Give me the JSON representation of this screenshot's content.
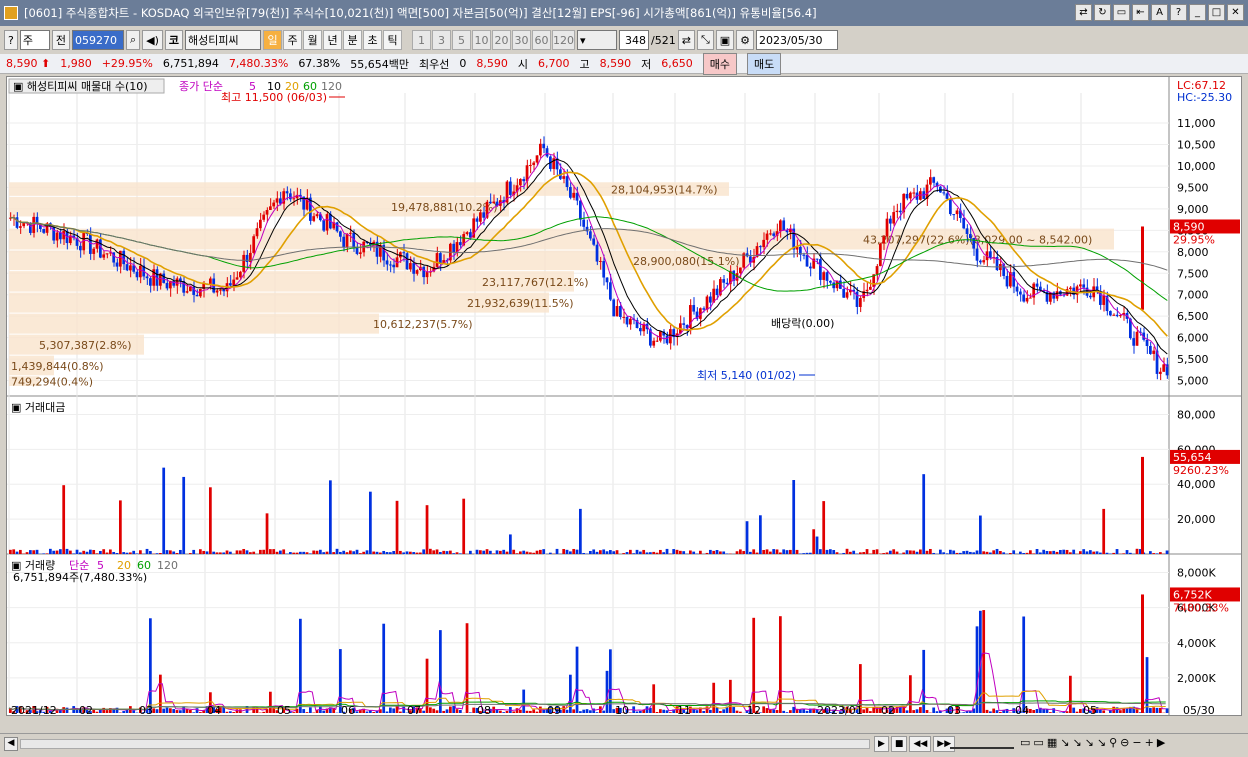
{
  "window": {
    "title": "[0601] 주식종합차트 - KOSDAQ 외국인보유[79(천)] 주식수[10,021(천)] 액면[500] 자본금[50(억)] 결산[12월] EPS[-96] 시가총액[861(억)] 유통비율[56.4]",
    "buttons": [
      "⇄",
      "↻",
      "▭",
      "⇤",
      "A",
      "?",
      "_",
      "□",
      "✕"
    ]
  },
  "toolbar": {
    "icon1": "?",
    "market": "주",
    "prev": "전",
    "code": "059270",
    "stock_tag": "코",
    "stock_name": "해성티피씨",
    "periods": [
      "일",
      "주",
      "월",
      "년",
      "분",
      "초",
      "틱"
    ],
    "minutes": [
      "1",
      "3",
      "5",
      "10",
      "20",
      "30",
      "60",
      "120"
    ],
    "count": "348",
    "total": "/521",
    "date": "2023/05/30"
  },
  "quote": {
    "price": "8,590",
    "change": "1,980",
    "change_pct": "+29.95%",
    "volume": "6,751,894",
    "vol_ratio": "7,480.33%",
    "turnover": "67.38%",
    "amount": "55,654백만",
    "best_label": "최우선",
    "best_val": "0",
    "last": "8,590",
    "open_label": "시",
    "open": "6,700",
    "high_label": "고",
    "high": "8,590",
    "low_label": "저",
    "low": "6,650",
    "buy": "매수",
    "sell": "매도"
  },
  "price_pane": {
    "label": "해성티피씨 매물대 수(10)",
    "ma_title": "종가 단순",
    "ma_periods": [
      "5",
      "10",
      "20",
      "60",
      "120"
    ],
    "ma_colors": [
      "#c000c0",
      "#000000",
      "#e0a000",
      "#00a000",
      "#707070"
    ],
    "lc": "LC:67.12",
    "hc": "HC:-25.30",
    "high_note": "최고 11,500 (06/03)",
    "low_note": "최저 5,140 (01/02)",
    "div_note": "배당락(0.00)",
    "last_price": "8,590",
    "last_pct": "29.95%",
    "y_ticks": [
      "11,000",
      "10,500",
      "10,000",
      "9,500",
      "9,000",
      "8,500",
      "8,000",
      "7,500",
      "7,000",
      "6,500",
      "6,000",
      "5,500",
      "5,000"
    ],
    "volume_profile": [
      {
        "text": "28,104,953(14.7%)"
      },
      {
        "text": "19,478,881(10.2%)"
      },
      {
        "text": "43,207,297(22.6%)(8,029.00 ~ 8,542.00)"
      },
      {
        "text": "28,900,080(15.1%)"
      },
      {
        "text": "23,117,767(12.1%)"
      },
      {
        "text": "21,932,639(11.5%)"
      },
      {
        "text": "10,612,237(5.7%)"
      },
      {
        "text": "5,307,387(2.8%)"
      },
      {
        "text": "1,439,844(0.8%)"
      },
      {
        "text": "749,294(0.4%)"
      }
    ]
  },
  "amount_pane": {
    "label": "거래대금",
    "y_ticks": [
      "80,000",
      "60,000",
      "40,000",
      "20,000"
    ],
    "last": "55,654",
    "last_pct": "9260.23%"
  },
  "volume_pane": {
    "label": "거래량",
    "ma_title": "단순",
    "ma_periods": [
      "5",
      "20",
      "60",
      "120"
    ],
    "sub": "6,751,894주(7,480.33%)",
    "y_ticks": [
      "8,000K",
      "6,000K",
      "4,000K",
      "2,000K"
    ],
    "last": "6,752K",
    "last_pct": "7480.33%"
  },
  "x_axis": [
    "2021/12",
    "02",
    "03",
    "04",
    "05",
    "06",
    "07",
    "08",
    "09",
    "10",
    "11",
    "12",
    "2023/01",
    "02",
    "03",
    "04",
    "05"
  ],
  "x_last": "05/30"
}
